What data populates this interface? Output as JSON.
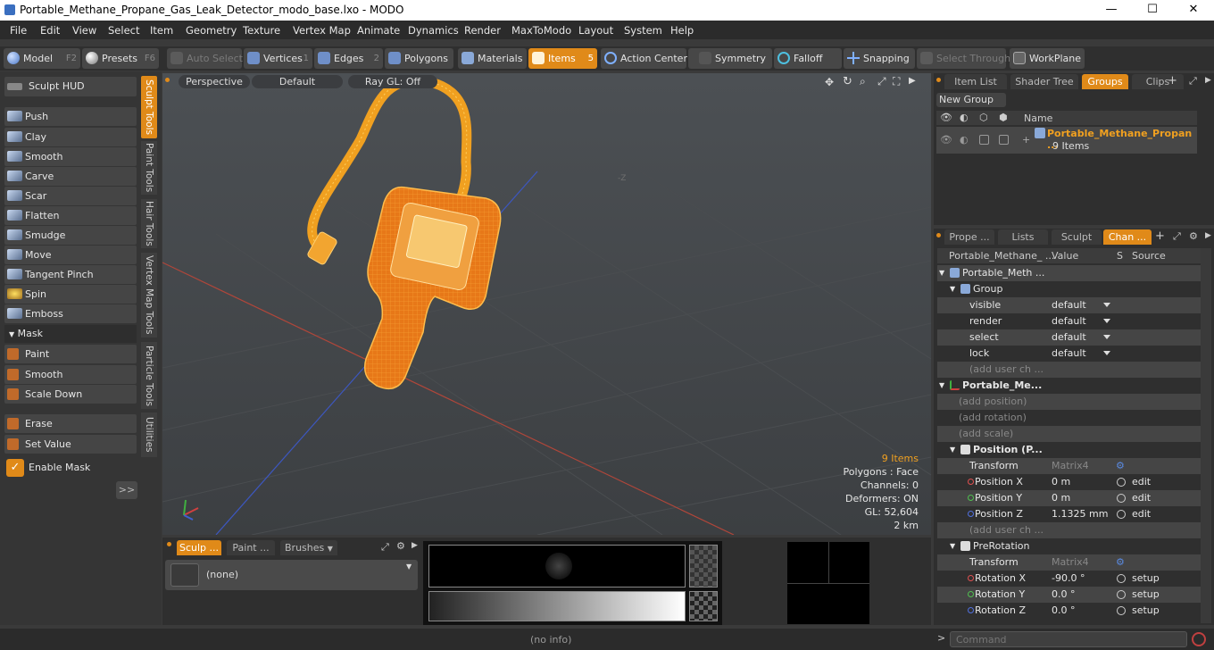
{
  "window": {
    "title": "Portable_Methane_Propane_Gas_Leak_Detector_modo_base.lxo - MODO",
    "minimize": "—",
    "maximize": "☐",
    "close": "✕"
  },
  "menu": [
    "File",
    "Edit",
    "View",
    "Select",
    "Item",
    "Geometry",
    "Texture",
    "Vertex Map",
    "Animate",
    "Dynamics",
    "Render",
    "MaxToModo",
    "Layout",
    "System",
    "Help"
  ],
  "toolbar": {
    "model": "Model",
    "model_key": "F2",
    "presets": "Presets",
    "presets_key": "F6",
    "auto_select": "Auto Select",
    "vertices": "Vertices",
    "vertices_key": "1",
    "edges": "Edges",
    "edges_key": "2",
    "polygons": "Polygons",
    "materials": "Materials",
    "items": "Items",
    "items_key": "5",
    "action_center": "Action Center",
    "symmetry": "Symmetry",
    "falloff": "Falloff",
    "snapping": "Snapping",
    "select_through": "Select Through",
    "workplane": "WorkPlane"
  },
  "left": {
    "sculpt_hud": "Sculpt HUD",
    "tools": [
      "Push",
      "Clay",
      "Smooth",
      "Carve",
      "Scar",
      "Flatten",
      "Smudge",
      "Move",
      "Tangent Pinch",
      "Spin",
      "Emboss"
    ],
    "mask_header": "Mask",
    "mask_tools": [
      "Paint",
      "Smooth",
      "Scale Down"
    ],
    "extra_tools": [
      "Erase",
      "Set Value"
    ],
    "enable_mask": "Enable Mask",
    "expand": ">>",
    "vtabs": [
      "Sculpt Tools",
      "Paint Tools",
      "Hair Tools",
      "Vertex Map Tools",
      "Particle Tools",
      "Utilities"
    ]
  },
  "viewport": {
    "perspective": "Perspective",
    "default": "Default",
    "raygl": "Ray GL: Off",
    "axis_label": "-Z",
    "info": {
      "items": "9 Items",
      "polygons": "Polygons : Face",
      "channels": "Channels: 0",
      "deformers": "Deformers: ON",
      "gl": "GL: 52,604",
      "scale": "2 km"
    }
  },
  "bottom": {
    "tabs": [
      "Sculp ...",
      "Paint ...",
      "Brushes"
    ],
    "preset": "(none)"
  },
  "status": {
    "center": "(no info)",
    "command_placeholder": "Command"
  },
  "items_panel": {
    "tabs": [
      "Item List",
      "Shader Tree",
      "Groups",
      "Clips"
    ],
    "new_group": "New Group",
    "name_header": "Name",
    "group_name": "Portable_Methane_Propan ...",
    "group_count": "9 Items"
  },
  "channels": {
    "tabs": [
      "Prope ...",
      "Lists",
      "Sculpt",
      "Chan ..."
    ],
    "headers": [
      "Portable_Methane_ ...",
      "Value",
      "S",
      "Source"
    ],
    "rows": [
      {
        "label": "Portable_Meth ...",
        "indent": 1,
        "type": "root"
      },
      {
        "label": "Group",
        "indent": 2,
        "type": "group"
      },
      {
        "label": "visible",
        "indent": 3,
        "value": "default",
        "dd": true
      },
      {
        "label": "render",
        "indent": 3,
        "value": "default",
        "dd": true
      },
      {
        "label": "select",
        "indent": 3,
        "value": "default",
        "dd": true
      },
      {
        "label": "lock",
        "indent": 3,
        "value": "default",
        "dd": true
      },
      {
        "label": "(add user ch ...",
        "indent": 3,
        "dim": true
      },
      {
        "label": "Portable_Me...",
        "indent": 1,
        "bold": true,
        "type": "locator"
      },
      {
        "label": "(add position)",
        "indent": 2,
        "dim": true
      },
      {
        "label": "(add rotation)",
        "indent": 2,
        "dim": true
      },
      {
        "label": "(add scale)",
        "indent": 2,
        "dim": true
      },
      {
        "label": "Position (P...",
        "indent": 2,
        "bold": true,
        "type": "xform"
      },
      {
        "label": "Transform",
        "indent": 3,
        "value": "Matrix4",
        "vdim": true,
        "gear": true
      },
      {
        "label": "Position X",
        "indent": 3,
        "value": "0 m",
        "dot": "#e05050",
        "radio": true,
        "source": "edit"
      },
      {
        "label": "Position Y",
        "indent": 3,
        "value": "0 m",
        "dot": "#50c050",
        "radio": true,
        "source": "edit"
      },
      {
        "label": "Position Z",
        "indent": 3,
        "value": "1.1325 mm",
        "dot": "#5070e0",
        "radio": true,
        "source": "edit"
      },
      {
        "label": "(add user ch ...",
        "indent": 3,
        "dim": true
      },
      {
        "label": "PreRotation",
        "indent": 2,
        "type": "xform"
      },
      {
        "label": "Transform",
        "indent": 3,
        "value": "Matrix4",
        "vdim": true,
        "gear": true
      },
      {
        "label": "Rotation X",
        "indent": 3,
        "value": "-90.0 °",
        "dot": "#e05050",
        "radio": true,
        "source": "setup"
      },
      {
        "label": "Rotation Y",
        "indent": 3,
        "value": "0.0 °",
        "dot": "#50c050",
        "radio": true,
        "source": "setup"
      },
      {
        "label": "Rotation Z",
        "indent": 3,
        "value": "0.0 °",
        "dot": "#5070e0",
        "radio": true,
        "source": "setup"
      }
    ]
  }
}
